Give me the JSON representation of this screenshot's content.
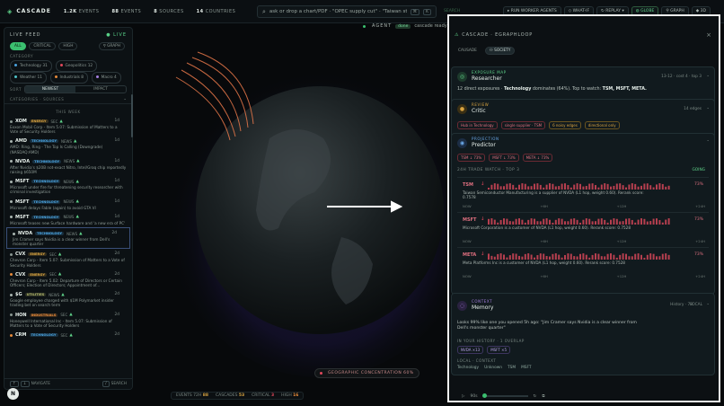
{
  "topbar": {
    "brand": "CASCADE",
    "stats": [
      {
        "value": "1.2K",
        "label": "EVENTS"
      },
      {
        "value": "88",
        "label": "EVENTS"
      },
      {
        "value": "8",
        "label": "SOURCES"
      },
      {
        "value": "14",
        "label": "COUNTRIES"
      }
    ],
    "search_placeholder": "ask or drop a chart/PDF · \"OPEC supply cut\" · \"Taiwan strait\"",
    "search_kbd": [
      "⌘",
      "K"
    ],
    "search_btn": "SEARCH",
    "buttons": [
      "RUN WORKER AGENTS",
      "WHAT-IF",
      "REPLAY",
      "GLOBE",
      "GRAPH",
      "3D"
    ]
  },
  "feed": {
    "title": "LIVE FEED",
    "live": "● LIVE",
    "filters": [
      "ALL",
      "CRITICAL",
      "HIGH"
    ],
    "graph_btn": "⚲ GRAPH",
    "category_label": "CATEGORY",
    "categories": [
      "Technology 31",
      "Geopolitics 12",
      "Weather 11",
      "Industrials 8",
      "Macro 4"
    ],
    "sort_label": "SORT",
    "sort": [
      "NEWEST",
      "IMPACT"
    ],
    "sources_row": "CATEGORIES · SOURCES",
    "section": "THIS WEEK",
    "items": [
      {
        "ticker": "XOM",
        "tag": "ENERGY",
        "type": "SEC",
        "age": "1d",
        "text": "Exxon Mobil Corp - Item 5.07: Submission of Matters to a Vote of Security Holders"
      },
      {
        "ticker": "AMD",
        "tag": "TECHNOLOGY",
        "type": "NEWS",
        "age": "1d",
        "text": "AMD: Ring, Ring - The Top Is Calling (Downgrade) (NASDAQ:AMD)"
      },
      {
        "ticker": "NVDA",
        "tag": "TECHNOLOGY",
        "type": "NEWS",
        "age": "1d",
        "text": "After Nvidia's $20B not-exact Nitro, Intel/Groq chip reportedly raising $650M"
      },
      {
        "ticker": "MSFT",
        "tag": "TECHNOLOGY",
        "type": "NEWS",
        "age": "1d",
        "text": "Microsoft under fire for threatening security researcher with criminal investigation"
      },
      {
        "ticker": "MSFT",
        "tag": "TECHNOLOGY",
        "type": "NEWS",
        "age": "1d",
        "text": "Microsoft delays Fable (again) to avoid GTA VI"
      },
      {
        "ticker": "MSFT",
        "tag": "TECHNOLOGY",
        "type": "NEWS",
        "age": "1d",
        "text": "Microsoft teases new Surface hardware and 'a new era of PC'"
      },
      {
        "ticker": "NVDA",
        "tag": "TECHNOLOGY",
        "type": "NEWS",
        "age": "2d",
        "text": "Jim Cramer says Nvidia is a clear winner from Dell's monster quarter"
      },
      {
        "ticker": "CVX",
        "tag": "ENERGY",
        "type": "SEC",
        "age": "2d",
        "text": "Chevron Corp - Item 5.07: Submission of Matters to a Vote of Security Holders"
      },
      {
        "ticker": "CVX",
        "tag": "ENERGY",
        "type": "SEC",
        "age": "2d",
        "text": "Chevron Corp - Item 5.02: Departure of Directors or Certain Officers; Election of Directors; Appointment of..."
      },
      {
        "ticker": "$G",
        "tag": "UTILITIES",
        "type": "NEWS",
        "age": "2d",
        "text": "Google employee charged with $1M Polymarket insider trading bet on search term"
      },
      {
        "ticker": "HON",
        "tag": "INDUSTRIALS",
        "type": "SEC",
        "age": "2d",
        "text": "Honeywell International Inc - Item 5.07: Submission of Matters to a Vote of Security Holders"
      },
      {
        "ticker": "CRM",
        "tag": "TECHNOLOGY",
        "type": "SEC",
        "age": "2d",
        "text": ""
      }
    ],
    "footer_nav": "NAVIGATE",
    "footer_search": "SEARCH"
  },
  "agent": {
    "label": "AGENT",
    "status": "done",
    "message": "cascade ready · 14 nodes · gemini synth done"
  },
  "globe": {
    "geo_label": "GEOGRAPHIC CONCENTRATION 60%",
    "bottom": [
      {
        "label": "EVENTS 72H",
        "value": "88"
      },
      {
        "label": "CASCADES",
        "value": "53"
      },
      {
        "label": "CRITICAL",
        "value": "3"
      },
      {
        "label": "HIGH",
        "value": "16"
      }
    ]
  },
  "panel": {
    "title": "CASCADE · EGRAPHLOOP",
    "tabs": [
      "CAUSADE",
      "SOCIETY"
    ],
    "researcher": {
      "kind": "EXPOSURE MAP",
      "name": "Researcher",
      "meta": "13-12 · cost 4 · top 3",
      "summary_pre": "12 direct exposures · ",
      "summary_bold": "Technology",
      "summary_mid": " dominates (64%). Top to watch: ",
      "summary_end": "TSM, MSFT, META."
    },
    "critic": {
      "kind": "REVIEW",
      "name": "Critic",
      "meta": "14 edges",
      "flags": [
        "Hub in Technology",
        "single supplier · TSM",
        "6 noisy edges",
        "directional only"
      ]
    },
    "predictor": {
      "kind": "PROJECTION",
      "name": "Predictor",
      "pills": [
        "TSM ↓ 73%",
        "MSFT ↓ 73%",
        "META ↓ 73%"
      ],
      "section": "24H TRADE WATCH · TOP 3",
      "section_right": "GOING",
      "axis": [
        "NOW",
        "+6H",
        "+12H",
        "+24H"
      ],
      "rows": [
        {
          "ticker": "TSM",
          "pct": "73%",
          "text": "Taiwan Semiconductor Manufacturing is a supplier of NVDA (L1 hop, weight 0.60). Rerank score: 0.7578"
        },
        {
          "ticker": "MSFT",
          "pct": "73%",
          "text": "Microsoft Corporation is a customer of NVDA (L1 hop, weight 0.60). Rerank score: 0.7528"
        },
        {
          "ticker": "META",
          "pct": "73%",
          "text": "Meta Platforms Inc is a customer of NVDA (L1 hop, weight 0.60). Rerank score: 0.7528"
        }
      ]
    },
    "memory": {
      "kind": "CONTEXT",
      "name": "Memory",
      "meta": "History · 78",
      "text": "Looks 99% like one you opened 5h ago: \"Jim Cramer says Nvidia is a clear winner from Dell's monster quarter\"",
      "history_label": "IN YOUR HISTORY · 1 OVERLAP",
      "history_pills": [
        "NVDA ×13",
        "MSFT ×5"
      ],
      "local_label": "LOCAL · CONTEXT",
      "local": [
        "Technology",
        "Unknown",
        "TSM",
        "MSFT"
      ]
    },
    "player": {
      "speed": "90s"
    }
  },
  "colors": {
    "accent": "#3bbf6f",
    "down": "#e0485b",
    "energy": "#d9a441",
    "technology": "#4aa3df",
    "utilities": "#b0b56a",
    "industrials": "#e68a3a"
  }
}
